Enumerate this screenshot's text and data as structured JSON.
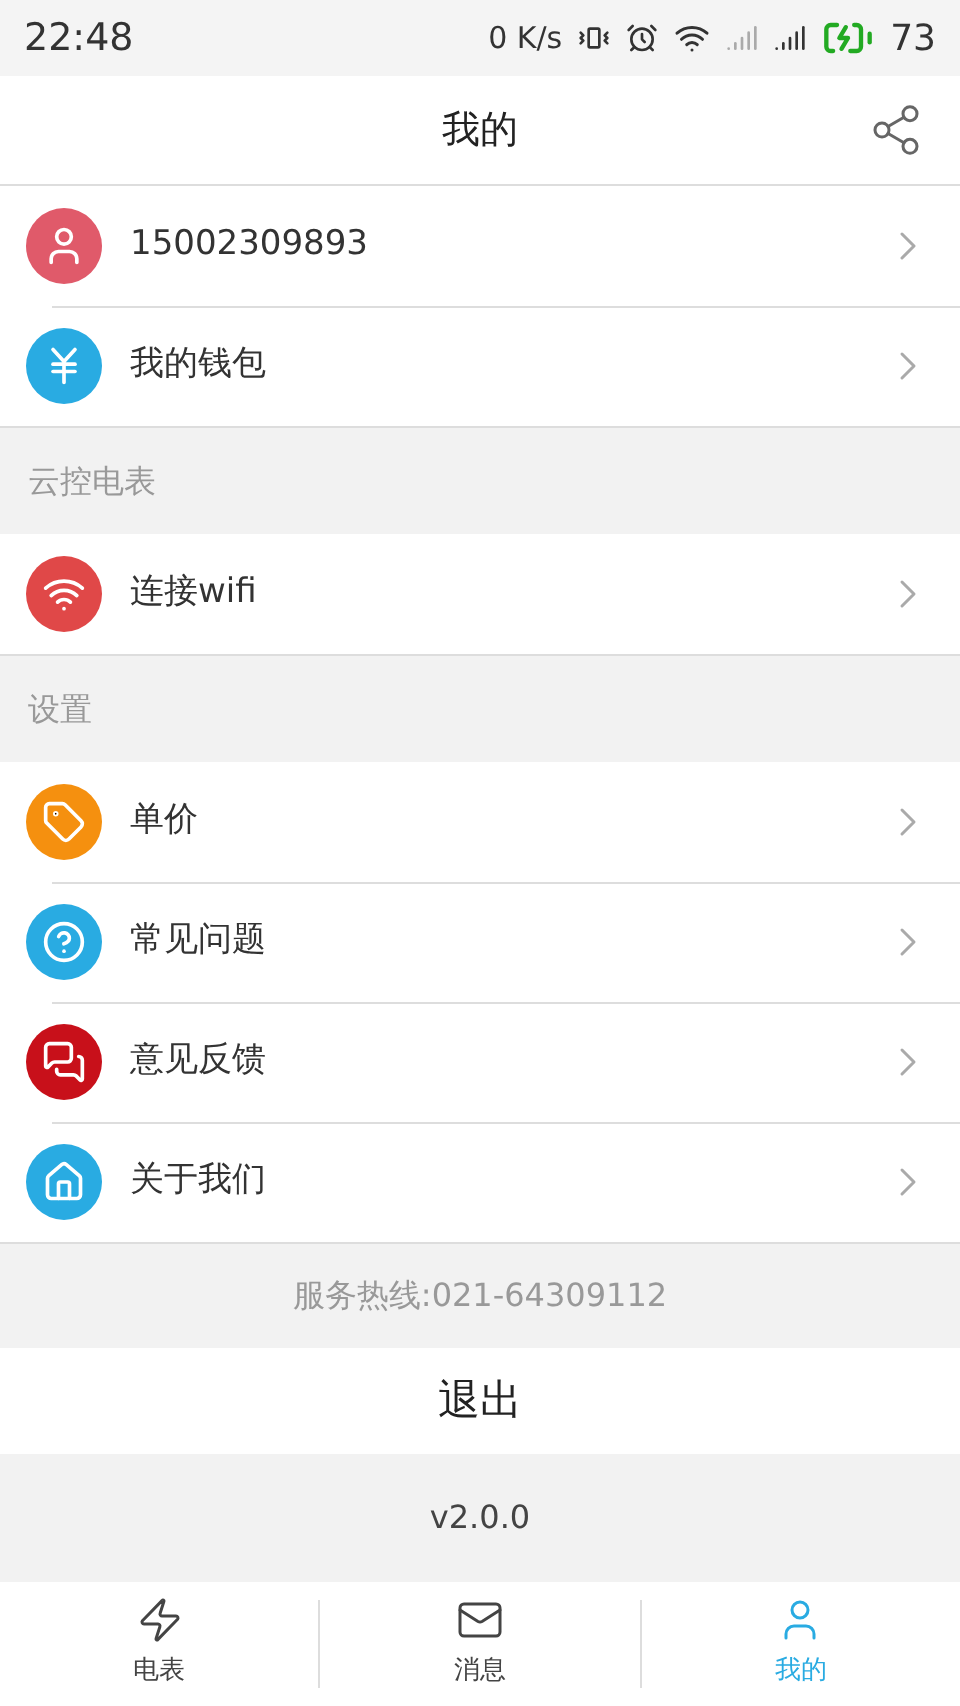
{
  "status_bar": {
    "time": "22:48",
    "speed": "0 K/s",
    "battery": "73"
  },
  "header": {
    "title": "我的"
  },
  "groups": [
    {
      "items": [
        {
          "kind": "user",
          "color": "#e05a6a",
          "label": "15002309893"
        },
        {
          "kind": "wallet",
          "color": "#29abe2",
          "label": "我的钱包"
        }
      ]
    },
    {
      "title": "云控电表",
      "items": [
        {
          "kind": "wifi",
          "color": "#e04848",
          "label": "连接wifi"
        }
      ]
    },
    {
      "title": "设置",
      "items": [
        {
          "kind": "price",
          "color": "#f5900f",
          "label": "单价"
        },
        {
          "kind": "faq",
          "color": "#29abe2",
          "label": "常见问题"
        },
        {
          "kind": "feedback",
          "color": "#c8101a",
          "label": "意见反馈"
        },
        {
          "kind": "about",
          "color": "#29abe2",
          "label": "关于我们"
        }
      ]
    }
  ],
  "hotline": "服务热线:021-64309112",
  "logout": "退出",
  "version": "v2.0.0",
  "tabs": [
    {
      "kind": "meter",
      "label": "电表",
      "selected": false
    },
    {
      "kind": "message",
      "label": "消息",
      "selected": false
    },
    {
      "kind": "me",
      "label": "我的",
      "selected": true
    }
  ]
}
